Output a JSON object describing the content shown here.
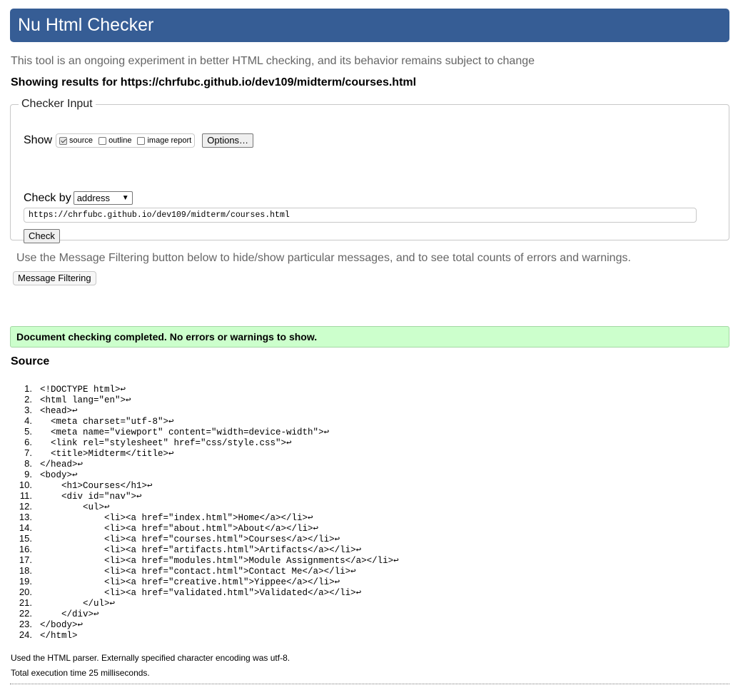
{
  "header": {
    "title": "Nu Html Checker"
  },
  "tagline": "This tool is an ongoing experiment in better HTML checking, and its behavior remains subject to change",
  "showing_results": "Showing results for https://chrfubc.github.io/dev109/midterm/courses.html",
  "checker_input": {
    "legend": "Checker Input",
    "show_label": "Show",
    "options": [
      {
        "label": "source",
        "checked": true
      },
      {
        "label": "outline",
        "checked": false
      },
      {
        "label": "image report",
        "checked": false
      }
    ],
    "options_button": "Options…",
    "check_by_label": "Check by",
    "check_by_value": "address",
    "url_value": "https://chrfubc.github.io/dev109/midterm/courses.html",
    "check_button": "Check"
  },
  "filter": {
    "note": "Use the Message Filtering button below to hide/show particular messages, and to see total counts of errors and warnings.",
    "button": "Message Filtering"
  },
  "result_message": "Document checking completed. No errors or warnings to show.",
  "source": {
    "title": "Source",
    "lines": [
      "<!DOCTYPE html>↩",
      "<html lang=\"en\">↩",
      "<head>↩",
      "  <meta charset=\"utf-8\">↩",
      "  <meta name=\"viewport\" content=\"width=device-width\">↩",
      "  <link rel=\"stylesheet\" href=\"css/style.css\">↩",
      "  <title>Midterm</title>↩",
      "</head>↩",
      "<body>↩",
      "    <h1>Courses</h1>↩",
      "    <div id=\"nav\">↩",
      "        <ul>↩",
      "            <li><a href=\"index.html\">Home</a></li>↩",
      "            <li><a href=\"about.html\">About</a></li>↩",
      "            <li><a href=\"courses.html\">Courses</a></li>↩",
      "            <li><a href=\"artifacts.html\">Artifacts</a></li>↩",
      "            <li><a href=\"modules.html\">Module Assignments</a></li>↩",
      "            <li><a href=\"contact.html\">Contact Me</a></li>↩",
      "            <li><a href=\"creative.html\">Yippee</a></li>↩",
      "            <li><a href=\"validated.html\">Validated</a></li>↩",
      "        </ul>↩",
      "    </div>↩",
      "</body>↩",
      "</html>"
    ]
  },
  "footer": {
    "parser_note": "Used the HTML parser. Externally specified character encoding was utf-8.",
    "execution_time": "Total execution time 25 milliseconds."
  }
}
